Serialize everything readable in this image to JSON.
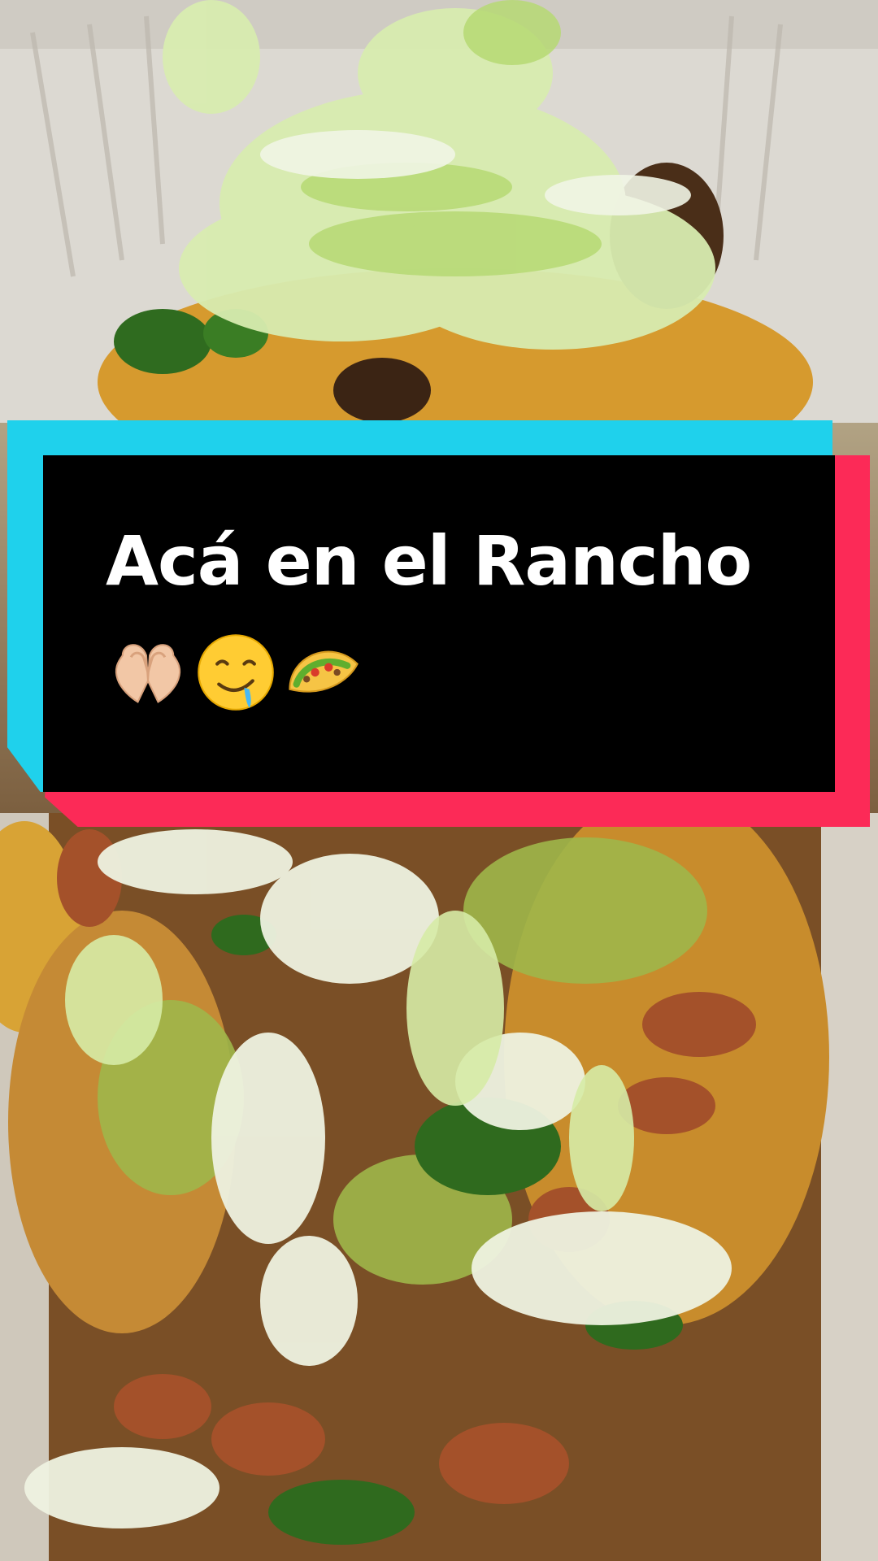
{
  "overlay": {
    "title": "Acá en el Rancho",
    "emojis": [
      "heart-hands-icon",
      "drooling-face-icon",
      "taco-icon"
    ]
  },
  "colors": {
    "card_black": "#000000",
    "card_cyan": "#1fd1ec",
    "card_red": "#fc2a57",
    "title_text": "#ffffff"
  }
}
